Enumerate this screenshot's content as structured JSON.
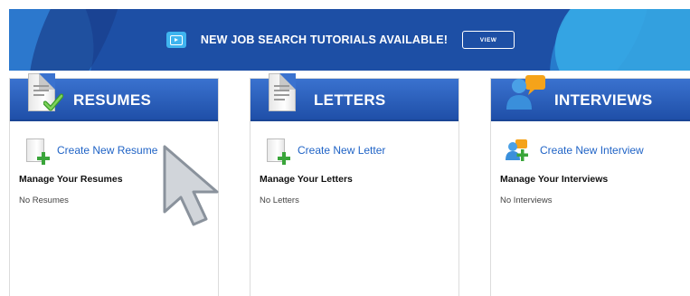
{
  "banner": {
    "text": "NEW JOB SEARCH TUTORIALS AVAILABLE!",
    "button_label": "VIEW",
    "play_icon": "video-play-icon"
  },
  "cards": [
    {
      "title": "RESUMES",
      "icon": "resume-document-check-icon",
      "create_label": "Create New Resume",
      "create_icon": "new-document-plus-icon",
      "manage_title": "Manage Your Resumes",
      "empty_text": "No Resumes"
    },
    {
      "title": "LETTERS",
      "icon": "letter-document-icon",
      "create_label": "Create New Letter",
      "create_icon": "new-document-plus-icon",
      "manage_title": "Manage Your Letters",
      "empty_text": "No Letters"
    },
    {
      "title": "INTERVIEWS",
      "icon": "interview-people-icon",
      "create_label": "Create New Interview",
      "create_icon": "new-interview-plus-icon",
      "manage_title": "Manage Your Interviews",
      "empty_text": "No Interviews"
    }
  ],
  "colors": {
    "banner_bg": "#1d4fa5",
    "header_bg": "#2d63bf",
    "link": "#1f63c6",
    "plus_green": "#3aa53a"
  },
  "cursor_icon": "mouse-pointer-arrow-icon"
}
